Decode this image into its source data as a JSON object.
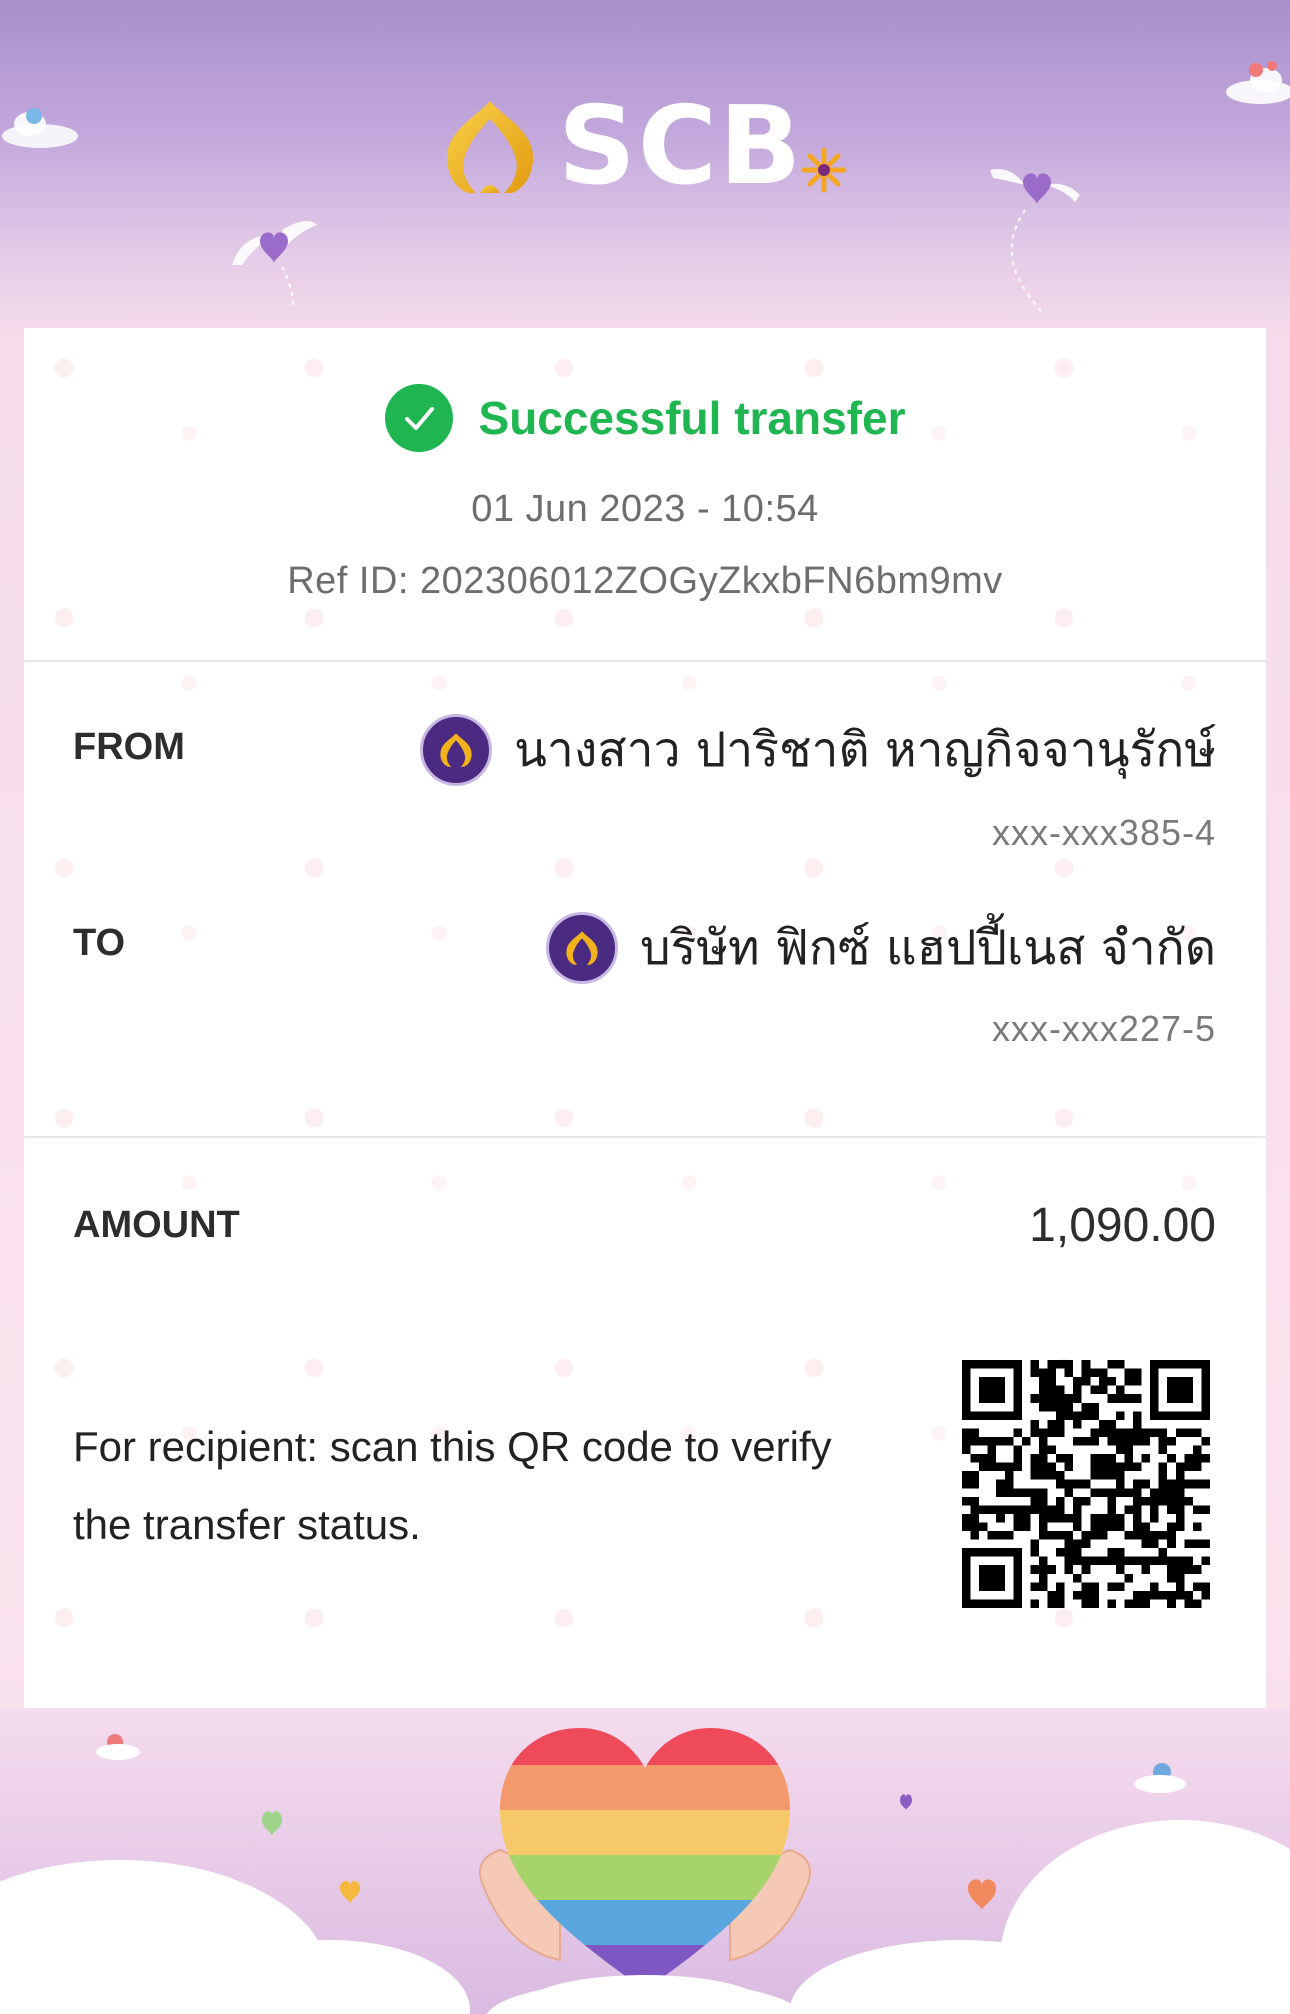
{
  "brand": {
    "name": "SCB",
    "gold": "#f2b21b",
    "purple": "#4b2a82"
  },
  "receipt": {
    "status": "Successful transfer",
    "datetime": "01 Jun 2023 - 10:54",
    "ref_label": "Ref ID:",
    "ref_id": "202306012ZOGyZkxbFN6bm9mv",
    "from": {
      "label": "FROM",
      "name": "นางสาว ปาริชาติ หาญกิจจานุรักษ์",
      "account": "xxx-xxx385-4"
    },
    "to": {
      "label": "TO",
      "name": "บริษัท ฟิกซ์ แฮปปี้เนส จำกัด",
      "account": "xxx-xxx227-5"
    },
    "amount": {
      "label": "AMOUNT",
      "value": "1,090.00"
    },
    "qr_note": "For recipient: scan this QR code to verify the transfer status."
  },
  "colors": {
    "success": "#1fb651",
    "text": "#2d2d2d",
    "muted": "#6d6d6d"
  },
  "icons": [
    "scb-logo-icon",
    "sparkle-icon",
    "check-circle-icon",
    "winged-heart-icon",
    "cloud-icon",
    "rainbow-heart-icon",
    "qr-code-icon"
  ]
}
